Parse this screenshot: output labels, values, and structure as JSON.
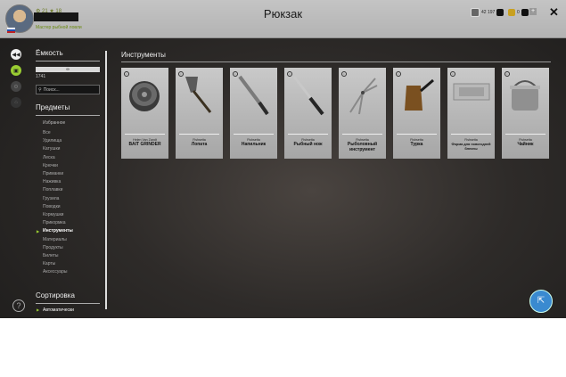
{
  "window": {
    "title": "Рюкзак",
    "close_icon": "✕"
  },
  "user": {
    "level_line": "⚙ 21  ★ 18",
    "rank": "Мастер рыбной ловли"
  },
  "currency": {
    "silver": "42 197",
    "gold": "0"
  },
  "panel": {
    "capacity_title": "Ёмкость",
    "capacity_bar": "∞",
    "capacity_value": "1741",
    "search_placeholder": "Поиск...",
    "items_title": "Предметы",
    "favorites": "Избранное",
    "categories": [
      "Все",
      "Удилища",
      "Катушки",
      "Леска",
      "Крючки",
      "Приманки",
      "Наживка",
      "Поплавки",
      "Грузила",
      "Поводки",
      "Кормушки",
      "Прикормка",
      "Инструменты",
      "Материалы",
      "Продукты",
      "Билеты",
      "Карты",
      "Аксессуары"
    ],
    "active_category": "Инструменты",
    "sort_title": "Сортировка",
    "sort_value": "Автоматически"
  },
  "section": {
    "title": "Инструменты"
  },
  "items": [
    {
      "brand": "Helen Van Zandt",
      "name": "BAIT GRINDER",
      "icon": "grinder-icon"
    },
    {
      "brand": "Fishsetta",
      "name": "Лопата",
      "icon": "shovel-icon"
    },
    {
      "brand": "Fishsetta",
      "name": "Напильник",
      "icon": "file-icon"
    },
    {
      "brand": "Fishsetta",
      "name": "Рыбный нож",
      "icon": "knife-icon"
    },
    {
      "brand": "Fishsetta",
      "name": "Рыболовный инструмент",
      "icon": "pliers-icon"
    },
    {
      "brand": "Fishsetta",
      "name": "Турка",
      "icon": "turka-icon"
    },
    {
      "brand": "Fishsetta",
      "name": "Форма для новогодней блесны",
      "icon": "mold-icon"
    },
    {
      "brand": "Fishsetta",
      "name": "Чайник",
      "icon": "kettle-icon"
    }
  ],
  "colors": {
    "accent": "#9acd32",
    "card": "#bdbdbd",
    "background": "#2e2b29",
    "cursor_button": "#3a8ad0"
  }
}
